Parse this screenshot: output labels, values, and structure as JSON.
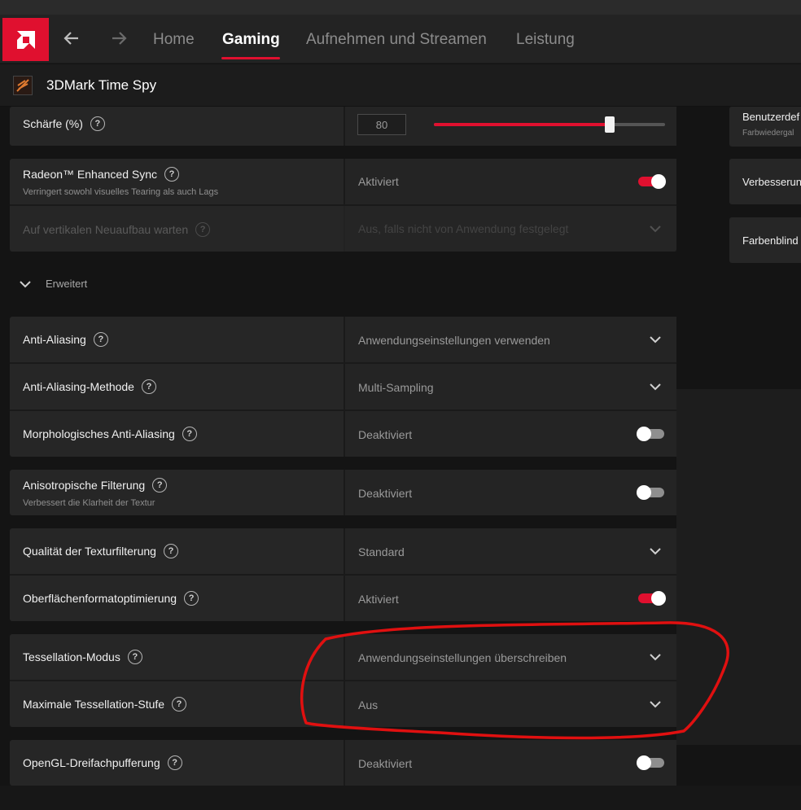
{
  "nav": {
    "tabs": [
      {
        "label": "Home"
      },
      {
        "label": "Gaming"
      },
      {
        "label": "Aufnehmen und Streamen"
      },
      {
        "label": "Leistung"
      }
    ],
    "active_tab": "Gaming"
  },
  "game": {
    "title": "3DMark Time Spy"
  },
  "sharpness": {
    "label": "Schärfe (%)",
    "value": "80",
    "slider_fraction": 0.76
  },
  "enhanced_sync": {
    "label": "Radeon™ Enhanced Sync",
    "sublabel": "Verringert sowohl visuelles Tearing als auch Lags",
    "value": "Aktiviert",
    "on": true
  },
  "vsync": {
    "label": "Auf vertikalen Neuaufbau warten",
    "value": "Aus, falls nicht von Anwendung festgelegt"
  },
  "expander": {
    "label": "Erweitert"
  },
  "settings": {
    "anti_aliasing": {
      "label": "Anti-Aliasing",
      "value": "Anwendungseinstellungen verwenden"
    },
    "aa_method": {
      "label": "Anti-Aliasing-Methode",
      "value": "Multi-Sampling"
    },
    "morph_aa": {
      "label": "Morphologisches Anti-Aliasing",
      "value": "Deaktiviert",
      "on": false
    },
    "aniso": {
      "label": "Anisotropische Filterung",
      "sublabel": "Verbessert die Klarheit der Textur",
      "value": "Deaktiviert",
      "on": false
    },
    "tex_quality": {
      "label": "Qualität der Texturfilterung",
      "value": "Standard"
    },
    "surface_opt": {
      "label": "Oberflächenformatoptimierung",
      "value": "Aktiviert",
      "on": true
    },
    "tess_mode": {
      "label": "Tessellation-Modus",
      "value": "Anwendungseinstellungen überschreiben"
    },
    "tess_level": {
      "label": "Maximale Tessellation-Stufe",
      "value": "Aus"
    },
    "opengl_triple": {
      "label": "OpenGL-Dreifachpufferung",
      "value": "Deaktiviert",
      "on": false
    }
  },
  "right_panel": {
    "items": [
      {
        "title": "Benutzerdef",
        "subtitle": "Farbwiedergal"
      },
      {
        "title": "Verbesserun"
      },
      {
        "title": "Farbenblind"
      }
    ]
  },
  "colors": {
    "accent": "#e0102f",
    "annotation": "#e01010"
  },
  "help_glyph": "?"
}
